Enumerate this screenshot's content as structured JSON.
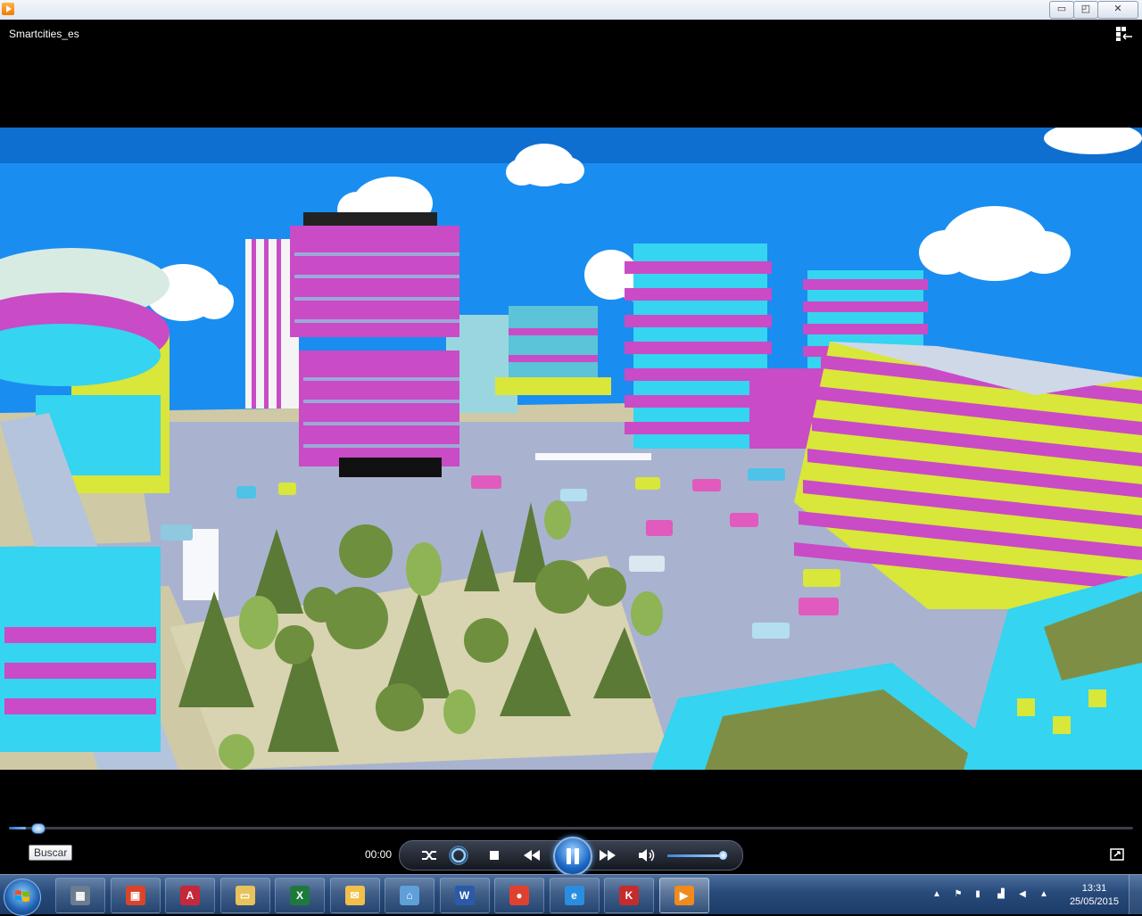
{
  "window": {
    "title_bar_icon": "media-player-icon",
    "minimize_icon": "minimize-icon",
    "restore_icon": "restore-icon",
    "close_icon": "close-icon",
    "minimize_label": "▭",
    "restore_label": "◰",
    "close_label": "✕"
  },
  "player": {
    "media_title": "Smartcities_es",
    "switch_to_library_icon": "switch-view-icon",
    "seek_tooltip": "Buscar",
    "time": "00:00",
    "progress_fraction": 0.015,
    "volume_fraction": 0.95,
    "controls": {
      "shuffle_icon": "shuffle-icon",
      "repeat_icon": "repeat-icon",
      "stop_icon": "stop-icon",
      "previous_icon": "previous-icon",
      "pause_icon": "pause-icon",
      "next_icon": "next-icon",
      "volume_icon": "speaker-icon",
      "fullscreen_icon": "fullscreen-icon"
    }
  },
  "scene_colors": {
    "sky": "#1a8df0",
    "building_pink": "#c94bc6",
    "building_lime": "#d9e63a",
    "building_cyan": "#35d4f0",
    "tree_green": "#5b7a36",
    "road": "#a9b3d0",
    "ground": "#cfc9a6"
  },
  "taskbar": {
    "apps": [
      {
        "name": "calculator-app",
        "glyph": "▦",
        "color": "#6b7d8f"
      },
      {
        "name": "presentation-app",
        "glyph": "▣",
        "color": "#d9452b"
      },
      {
        "name": "pdf-app",
        "glyph": "A",
        "color": "#c5283a"
      },
      {
        "name": "file-explorer-app",
        "glyph": "▭",
        "color": "#e8c25a"
      },
      {
        "name": "excel-app",
        "glyph": "X",
        "color": "#1e7a3c"
      },
      {
        "name": "mail-app",
        "glyph": "✉",
        "color": "#f0c04a"
      },
      {
        "name": "network-app",
        "glyph": "⌂",
        "color": "#5fa0d8"
      },
      {
        "name": "word-app",
        "glyph": "W",
        "color": "#2b5aa8"
      },
      {
        "name": "chrome-app",
        "glyph": "●",
        "color": "#e0412e"
      },
      {
        "name": "internet-explorer-app",
        "glyph": "e",
        "color": "#2a8ee0"
      },
      {
        "name": "kaspersky-app",
        "glyph": "K",
        "color": "#c42d2d"
      },
      {
        "name": "media-player-app",
        "glyph": "▶",
        "color": "#f08a1c"
      }
    ],
    "tray": {
      "clock_time": "13:31",
      "clock_date": "25/05/2015"
    }
  }
}
